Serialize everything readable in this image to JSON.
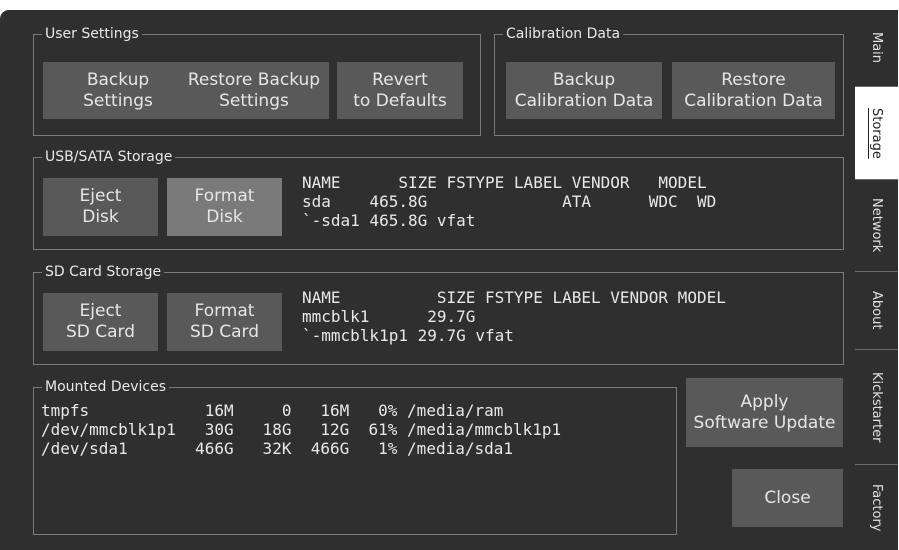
{
  "user_settings": {
    "legend": "User Settings",
    "backup_label": "Backup\nSettings",
    "restore_label": "Restore Backup\nSettings",
    "revert_label": "Revert\nto Defaults"
  },
  "calibration": {
    "legend": "Calibration Data",
    "backup_label": "Backup\nCalibration Data",
    "restore_label": "Restore\nCalibration Data"
  },
  "usb_storage": {
    "legend": "USB/SATA Storage",
    "eject_label": "Eject\nDisk",
    "format_label": "Format\nDisk",
    "listing": "NAME      SIZE FSTYPE LABEL VENDOR   MODEL\nsda    465.8G              ATA      WDC  WD\n`-sda1 465.8G vfat"
  },
  "sd_storage": {
    "legend": "SD Card Storage",
    "eject_label": "Eject\nSD Card",
    "format_label": "Format\nSD Card",
    "listing": "NAME          SIZE FSTYPE LABEL VENDOR MODEL\nmmcblk1      29.7G\n`-mmcblk1p1 29.7G vfat"
  },
  "mounted": {
    "legend": "Mounted Devices",
    "listing": "tmpfs            16M     0   16M   0% /media/ram\n/dev/mmcblk1p1   30G   18G   12G  61% /media/mmcblk1p1\n/dev/sda1       466G   32K  466G   1% /media/sda1"
  },
  "actions": {
    "apply_update_label": "Apply\nSoftware Update",
    "close_label": "Close"
  },
  "tabs": [
    {
      "label": "Main",
      "active": false
    },
    {
      "label": "Storage",
      "active": true
    },
    {
      "label": "Network",
      "active": false
    },
    {
      "label": "About",
      "active": false
    },
    {
      "label": "Kickstarter",
      "active": false
    },
    {
      "label": "Factory",
      "active": false
    }
  ]
}
